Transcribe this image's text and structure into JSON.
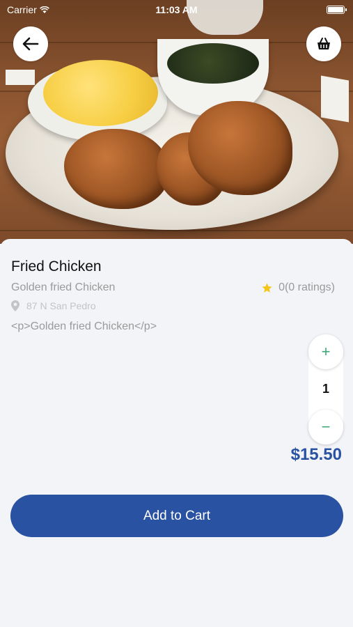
{
  "status_bar": {
    "carrier": "Carrier",
    "time": "11:03 AM"
  },
  "header": {
    "back_icon": "arrow-left-icon",
    "basket_icon": "basket-icon"
  },
  "product": {
    "name": "Fried Chicken",
    "subtitle": "Golden fried Chicken",
    "rating_text": "0(0 ratings)",
    "address": "87 N San Pedro",
    "description": "<p>Golden fried Chicken</p>",
    "quantity": "1",
    "price": "$15.50"
  },
  "actions": {
    "add_to_cart_label": "Add to Cart",
    "plus_label": "+",
    "minus_label": "−"
  },
  "colors": {
    "accent": "#2952a3",
    "stepper_green": "#3aa876",
    "star": "#f5c518",
    "background": "#f2f4f8"
  }
}
